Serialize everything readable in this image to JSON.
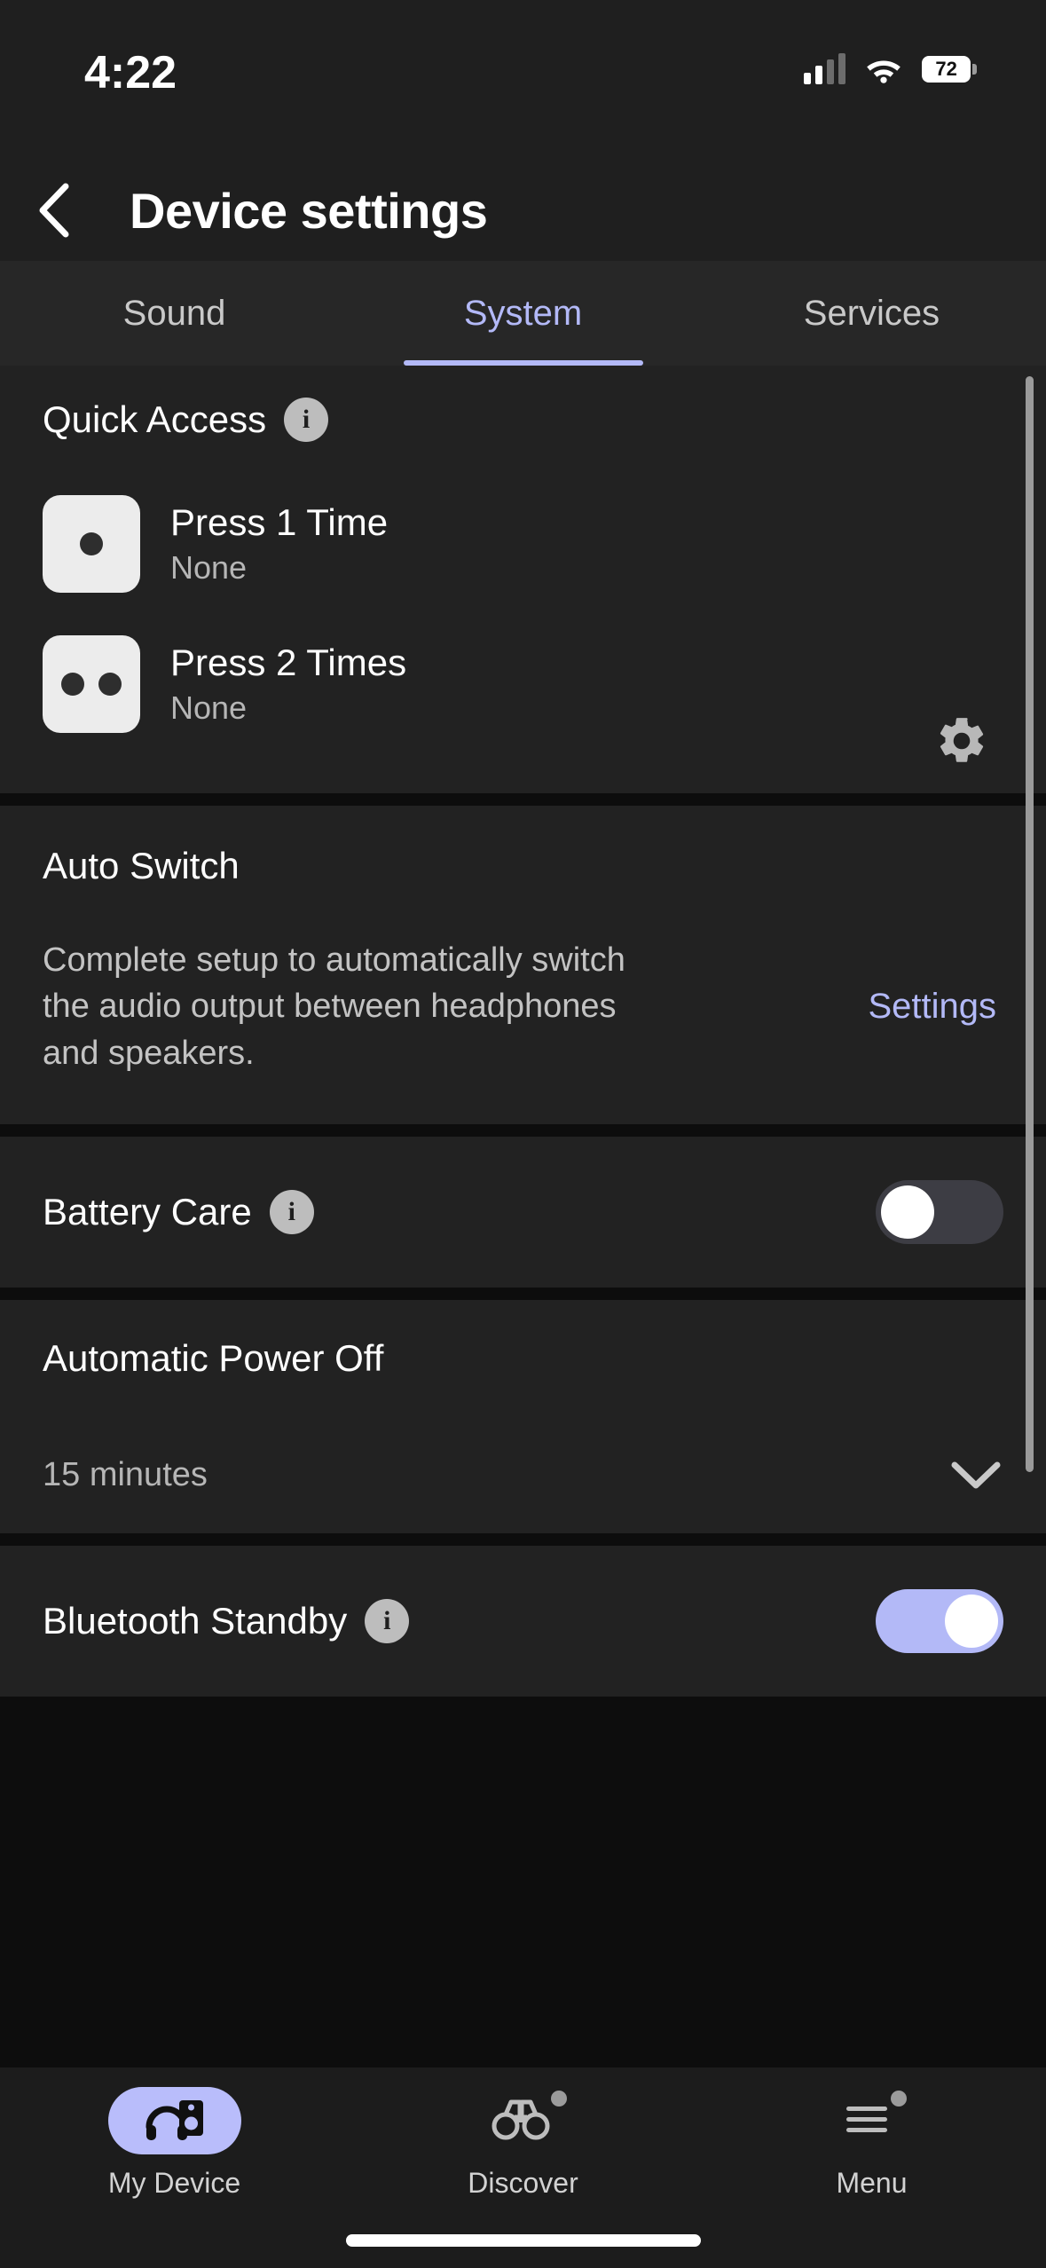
{
  "status_bar": {
    "time": "4:22",
    "battery_level": "72",
    "cellular_icon": "cellular-signal-icon",
    "wifi_icon": "wifi-icon",
    "battery_icon": "battery-icon"
  },
  "header": {
    "back_icon": "chevron-left-icon",
    "title": "Device settings"
  },
  "tabs": {
    "items": [
      {
        "label": "Sound",
        "active": false
      },
      {
        "label": "System",
        "active": true
      },
      {
        "label": "Services",
        "active": false
      }
    ],
    "active_color": "#b3b9f7"
  },
  "quick_access": {
    "title": "Quick Access",
    "info_icon": "info-icon",
    "info_glyph": "i",
    "gear_icon": "gear-icon",
    "rows": [
      {
        "icon": "one-dot-icon",
        "label": "Press 1 Time",
        "value": "None"
      },
      {
        "icon": "two-dots-icon",
        "label": "Press 2 Times",
        "value": "None"
      }
    ]
  },
  "auto_switch": {
    "title": "Auto Switch",
    "description": "Complete setup to automatically switch the audio output between headphones and speakers.",
    "link_label": "Settings",
    "link_color": "#b3b9f7"
  },
  "battery_care": {
    "label": "Battery Care",
    "info_icon": "info-icon",
    "info_glyph": "i",
    "toggle_state": "off"
  },
  "automatic_power_off": {
    "title": "Automatic Power Off",
    "value": "15 minutes",
    "chevron_icon": "chevron-down-icon"
  },
  "bluetooth_standby": {
    "label": "Bluetooth Standby",
    "info_icon": "info-icon",
    "info_glyph": "i",
    "toggle_state": "on"
  },
  "bottom_nav": {
    "items": [
      {
        "label": "My Device",
        "icon": "headphones-speaker-icon",
        "active": true,
        "badge": false
      },
      {
        "label": "Discover",
        "icon": "binoculars-icon",
        "active": false,
        "badge": true
      },
      {
        "label": "Menu",
        "icon": "hamburger-menu-icon",
        "active": false,
        "badge": true
      }
    ],
    "active_pill_color": "#b9bdfb"
  }
}
